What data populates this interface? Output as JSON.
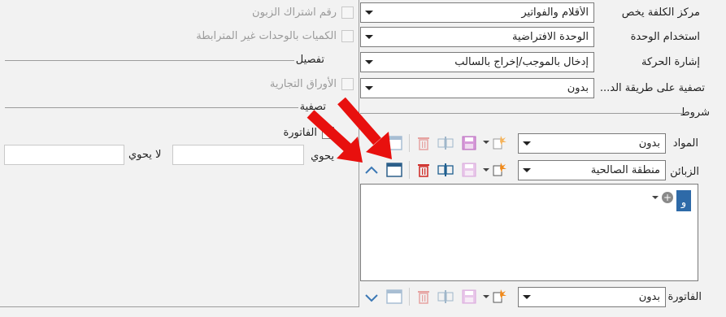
{
  "left": {
    "checks": [
      {
        "label": "رقم اشتراك الزبون",
        "enabled": false
      },
      {
        "label": "الكميات بالوحدات غير المترابطة",
        "enabled": false
      }
    ],
    "details_heading": "تفصيل",
    "details_checks": [
      {
        "label": "الأوراق التجارية",
        "enabled": false
      }
    ],
    "filter_heading": "تصفية",
    "filter_check_label": "الفاتورة",
    "contains_label": "يحوي",
    "not_contains_label": "لا يحوي",
    "contains_value": "",
    "not_contains_value": ""
  },
  "right": {
    "cost_center_label": "مركز الكلفة يخص",
    "cost_center_value": "الأقلام والفواتير",
    "unit_usage_label": "استخدام الوحدة",
    "unit_usage_value": "الوحدة الافتراضية",
    "movement_sign_label": "إشارة الحركة",
    "movement_sign_value": "إدخال بالموجب/إخراج بالسالب",
    "filter_method_label": "تصفية على طريقة الد...",
    "filter_method_value": "بدون",
    "conditions_heading": "شروط",
    "materials_label": "المواد",
    "materials_value": "بدون",
    "customers_label": "الزبائن",
    "customers_value": "منطقة الصالحية",
    "and_chip": "و",
    "invoice_label": "الفاتورة",
    "invoice_value": "بدون"
  },
  "colors": {
    "accent_blue": "#2e6aa8",
    "arrow_red": "#e8100e",
    "delete_red": "#d0312d",
    "save_purple": "#8a1f8f"
  }
}
